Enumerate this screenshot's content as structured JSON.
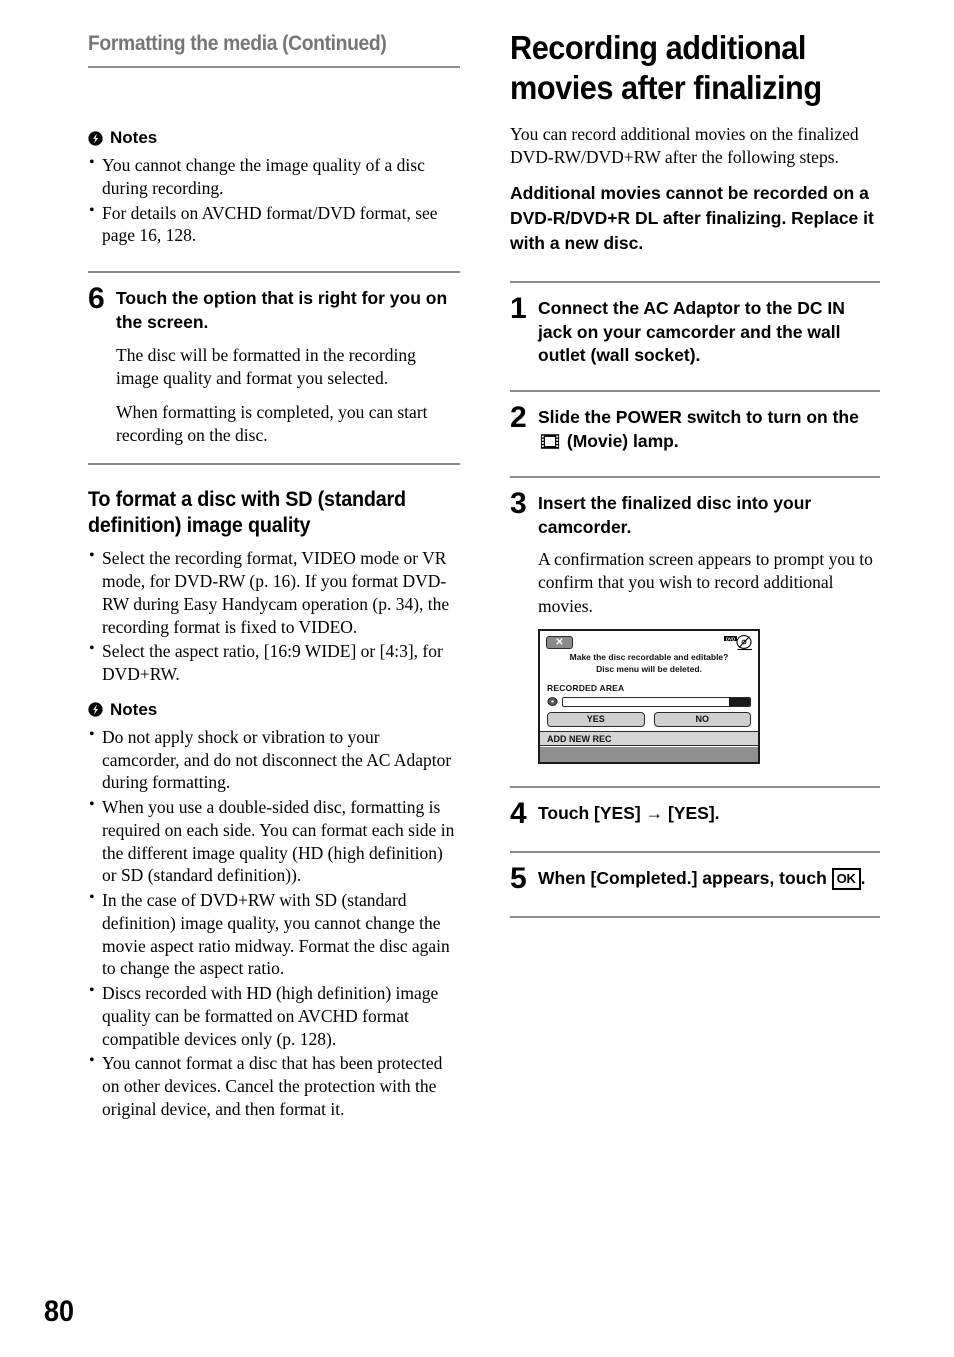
{
  "page": {
    "number": "80",
    "running_header": "Formatting the media (Continued)"
  },
  "left_column": {
    "notes_top": {
      "icon": "note-bolt-icon",
      "label": "Notes",
      "items": [
        "You cannot change the image quality of a disc during recording.",
        "For details on AVCHD format/DVD format, see page 16, 128."
      ]
    },
    "step6": {
      "number": "6",
      "title": "Touch the option that is right for you on the screen.",
      "paragraphs": [
        "The disc will be formatted in the recording image quality and format you selected.",
        "When formatting is completed, you can start recording on the disc."
      ]
    },
    "sd_section": {
      "heading": "To format a disc with SD (standard definition) image quality",
      "items": [
        "Select the recording format, VIDEO mode or VR mode, for DVD-RW (p. 16). If you format DVD-RW during Easy Handycam operation (p. 34), the recording format is fixed to VIDEO.",
        "Select the aspect ratio, [16:9 WIDE] or [4:3], for DVD+RW."
      ]
    },
    "notes_bottom": {
      "icon": "note-bolt-icon",
      "label": "Notes",
      "items": [
        "Do not apply shock or vibration to your camcorder, and do not disconnect the AC Adaptor during formatting.",
        "When you use a double-sided disc, formatting is required on each side. You can format each side in the different image quality (HD (high definition) or SD (standard definition)).",
        "In the case of DVD+RW with SD (standard definition) image quality, you cannot change the movie aspect ratio midway. Format the disc again to change the aspect ratio.",
        "Discs recorded with HD (high definition) image quality can be formatted on AVCHD format compatible devices only (p. 128).",
        "You cannot format a disc that has been protected on other devices. Cancel the protection with the original device, and then format it."
      ]
    }
  },
  "right_column": {
    "title": "Recording additional movies after finalizing",
    "intro": "You can record additional movies on the finalized DVD-RW/DVD+RW after the following steps.",
    "warning": "Additional movies cannot be recorded on a DVD-R/DVD+R DL after finalizing. Replace it with a new disc.",
    "step1": {
      "number": "1",
      "title": "Connect the AC Adaptor to the DC IN jack on your camcorder and the wall outlet (wall socket)."
    },
    "step2": {
      "number": "2",
      "title_before": "Slide the POWER switch to turn on the",
      "icon": "movie-film-icon",
      "title_after": "(Movie) lamp."
    },
    "step3": {
      "number": "3",
      "title": "Insert the finalized disc into your camcorder.",
      "body": "A confirmation screen appears to prompt you to confirm that you wish to record additional movies."
    },
    "step4": {
      "number": "4",
      "title_before": "Touch [YES]",
      "arrow": "→",
      "title_after": "[YES]."
    },
    "step5": {
      "number": "5",
      "title_before": "When [Completed.] appears, touch",
      "ok_label": "OK",
      "title_after": "."
    },
    "screen_illustration": {
      "close_label": "✕",
      "disc_icon": "dvd-edit-icon",
      "message_line1": "Make the disc recordable and editable?",
      "message_line2": "Disc menu will be deleted.",
      "area_label": "RECORDED AREA",
      "bar_disc_icon": "disc-icon",
      "bar_fill_percent": 11,
      "button_yes": "YES",
      "button_no": "NO",
      "strip_label": "ADD NEW REC"
    }
  },
  "colors": {
    "header_gray": "#767676",
    "rule_gray": "#8c8c8c",
    "screen_strip": "#d4d4d4",
    "screen_footer": "#8f8f8f",
    "screen_button": "#cfcfcf"
  }
}
